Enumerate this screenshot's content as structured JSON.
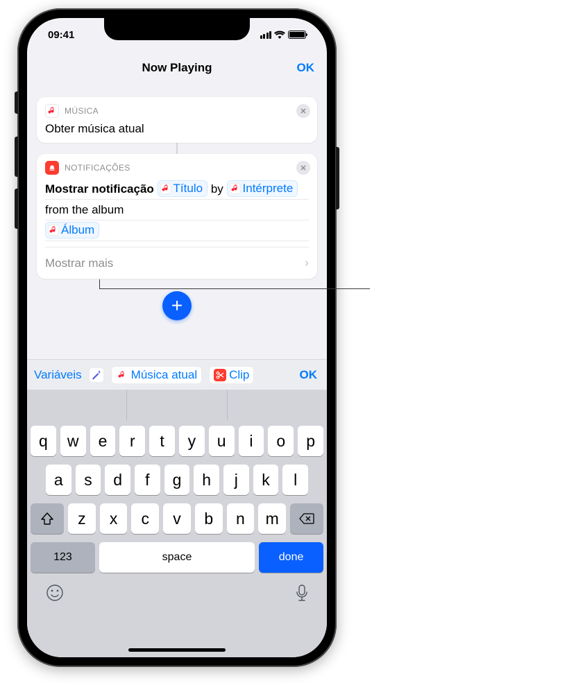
{
  "status": {
    "time": "09:41"
  },
  "nav": {
    "title": "Now Playing",
    "ok": "OK"
  },
  "card1": {
    "app_label": "MÚSICA",
    "title": "Obter música atual"
  },
  "card2": {
    "app_label": "NOTIFICAÇÕES",
    "action": "Mostrar notificação",
    "token_title": "Título",
    "text_by": "by",
    "token_artist": "Intérprete",
    "text_from": "from the album",
    "token_album": "Álbum",
    "show_more": "Mostrar mais"
  },
  "suggestions": {
    "variables": "Variáveis",
    "current_music": "Música atual",
    "clipboard": "Clip",
    "ok": "OK"
  },
  "keyboard": {
    "row1": [
      "q",
      "w",
      "e",
      "r",
      "t",
      "y",
      "u",
      "i",
      "o",
      "p"
    ],
    "row2": [
      "a",
      "s",
      "d",
      "f",
      "g",
      "h",
      "j",
      "k",
      "l"
    ],
    "row3": [
      "z",
      "x",
      "c",
      "v",
      "b",
      "n",
      "m"
    ],
    "numbers": "123",
    "space": "space",
    "done": "done"
  }
}
